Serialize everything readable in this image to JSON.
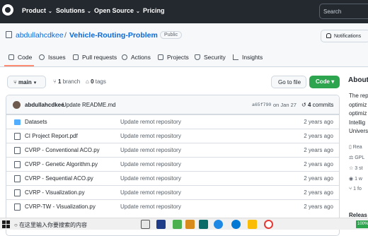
{
  "topnav": {
    "product": "Product",
    "solutions": "Solutions",
    "open_source": "Open Source",
    "pricing": "Pricing",
    "search_placeholder": "Search"
  },
  "repo": {
    "owner": "abdullahcdkee",
    "separator": "/",
    "name": "Vehicle-Routing-Problem",
    "visibility": "Public",
    "notifications": "Notifications"
  },
  "tabs": [
    "Code",
    "Issues",
    "Pull requests",
    "Actions",
    "Projects",
    "Security",
    "Insights"
  ],
  "toolbar": {
    "branch": "main",
    "branch_count": "1",
    "branch_label": "branch",
    "tag_count": "0",
    "tag_label": "tags",
    "go_to_file": "Go to file",
    "code": "Code"
  },
  "commit": {
    "author": "abdullahcdkee",
    "message": "Update README.md",
    "sha": "a65f790",
    "date": "on Jan 27",
    "count": "4",
    "count_label": "commits"
  },
  "files": [
    {
      "name": "Datasets",
      "type": "folder",
      "message": "Update remot repository",
      "age": "2 years ago"
    },
    {
      "name": "CI Project Report.pdf",
      "type": "file",
      "message": "Update remot repository",
      "age": "2 years ago"
    },
    {
      "name": "CVRP - Conventional ACO.py",
      "type": "file",
      "message": "Update remot repository",
      "age": "2 years ago"
    },
    {
      "name": "CVRP - Genetic Algorithm.py",
      "type": "file",
      "message": "Update remot repository",
      "age": "2 years ago"
    },
    {
      "name": "CVRP - Sequential ACO.py",
      "type": "file",
      "message": "Update remot repository",
      "age": "2 years ago"
    },
    {
      "name": "CVRP - Visualization.py",
      "type": "file",
      "message": "Update remot repository",
      "age": "2 years ago"
    },
    {
      "name": "CVRP-TW - Visualization.py",
      "type": "file",
      "message": "Update remot repository",
      "age": "2 years ago"
    }
  ],
  "about": {
    "heading": "About",
    "text_lines": [
      "The rep",
      "optimiz",
      "optimiz",
      "Intellig",
      "Univers"
    ],
    "sidebar": [
      "Rea",
      "GPL",
      "3 st",
      "1 w",
      "1 fo"
    ],
    "release_partial": "Releas"
  },
  "taskbar": {
    "search_text": "在这里输入你要搜索的内容",
    "zoom": "100%"
  }
}
